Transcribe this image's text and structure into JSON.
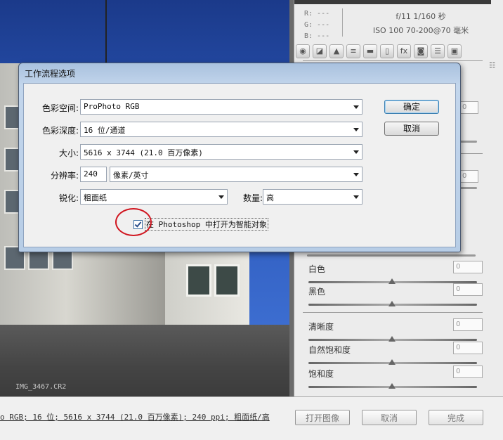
{
  "window": {
    "filename": "IMG_3467.CR2"
  },
  "info": {
    "r": "R:  ---",
    "g": "G:  ---",
    "b": "B:  ---",
    "exposure": "f/11   1/160 秒",
    "lens": "ISO 100   70-200@70 毫米"
  },
  "tool_tabs": [
    "basic-icon",
    "tone-curve-icon",
    "detail-icon",
    "hsl-icon",
    "split-toning-icon",
    "lens-corrections-icon",
    "fx-icon",
    "camera-calibration-icon",
    "presets-icon",
    "snapshots-icon"
  ],
  "sliders": [
    {
      "label": "白色",
      "value": "0"
    },
    {
      "label": "黑色",
      "value": "0"
    },
    {
      "label": "清晰度",
      "value": "0"
    },
    {
      "label": "自然饱和度",
      "value": "0"
    },
    {
      "label": "饱和度",
      "value": "0"
    }
  ],
  "stub_values": [
    "0",
    "0"
  ],
  "status_link": "o RGB; 16 位; 5616 x 3744 (21.0 百万像素); 240 ppi; 粗面纸/高",
  "bottom_buttons": {
    "open": "打开图像",
    "cancel": "取消",
    "done": "完成"
  },
  "dialog": {
    "title": "工作流程选项",
    "color_space_label": "色彩空间:",
    "color_space_value": "ProPhoto RGB",
    "depth_label": "色彩深度:",
    "depth_value": "16 位/通道",
    "size_label": "大小:",
    "size_value": "5616 x 3744  (21.0 百万像素)",
    "resolution_label": "分辨率:",
    "resolution_value": "240",
    "resolution_unit": "像素/英寸",
    "sharpen_label": "锐化:",
    "sharpen_value": "粗面纸",
    "amount_label": "数量:",
    "amount_value": "高",
    "ok": "确定",
    "cancel": "取消",
    "smart_object_label": "在 Photoshop 中打开为智能对象",
    "smart_object_checked": true
  },
  "colors": {
    "annotation_circle": "#d0141e",
    "dialog_frame": "#b7cde6"
  }
}
